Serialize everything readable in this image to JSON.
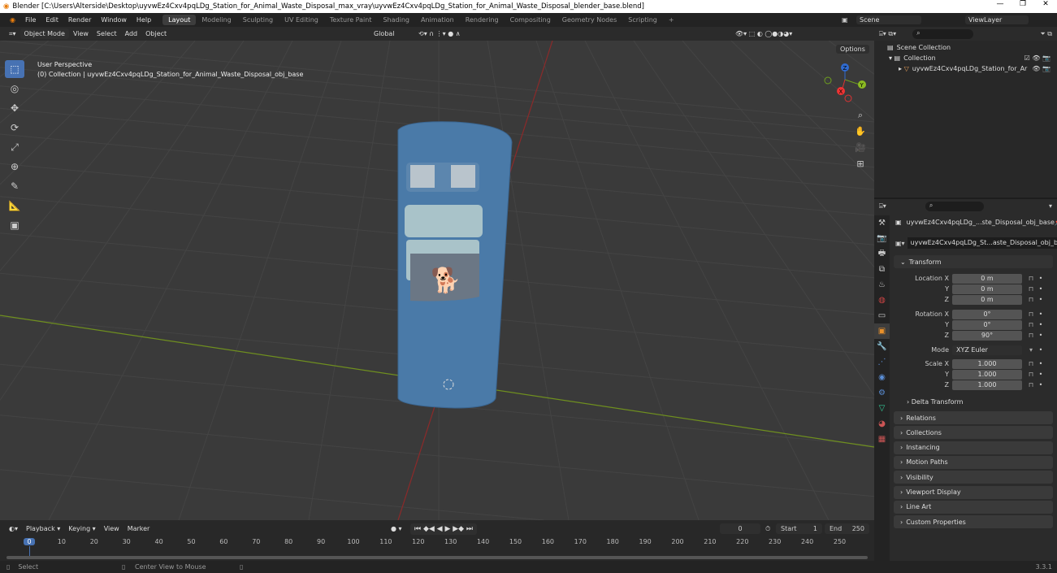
{
  "title": "Blender [C:\\Users\\Alterside\\Desktop\\uyvwEz4Cxv4pqLDg_Station_for_Animal_Waste_Disposal_max_vray\\uyvwEz4Cxv4pqLDg_Station_for_Animal_Waste_Disposal_blender_base.blend]",
  "menu": [
    "File",
    "Edit",
    "Render",
    "Window",
    "Help"
  ],
  "workspaces": [
    "Layout",
    "Modeling",
    "Sculpting",
    "UV Editing",
    "Texture Paint",
    "Shading",
    "Animation",
    "Rendering",
    "Compositing",
    "Geometry Nodes",
    "Scripting",
    "+"
  ],
  "scene": "Scene",
  "view_layer": "ViewLayer",
  "viewport_header": {
    "mode": "Object Mode",
    "menus": [
      "View",
      "Select",
      "Add",
      "Object"
    ],
    "orientation": "Global",
    "options": "Options"
  },
  "viewport_info": {
    "line1": "User Perspective",
    "line2": "(0) Collection | uyvwEz4Cxv4pqLDg_Station_for_Animal_Waste_Disposal_obj_base"
  },
  "gizmo": {
    "x": "X",
    "y": "Y",
    "z": "Z"
  },
  "outliner": {
    "root": "Scene Collection",
    "collection": "Collection",
    "object": "uyvwEz4Cxv4pqLDg_Station_for_Ar"
  },
  "properties": {
    "object_name": "uyvwEz4Cxv4pqLDg_...ste_Disposal_obj_base",
    "data_name": "uyvwEz4Cxv4pqLDg_St...aste_Disposal_obj_base",
    "transform": "Transform",
    "rows": [
      {
        "label": "Location X",
        "value": "0 m"
      },
      {
        "label": "Y",
        "value": "0 m"
      },
      {
        "label": "Z",
        "value": "0 m"
      },
      {
        "label": "Rotation X",
        "value": "0°"
      },
      {
        "label": "Y",
        "value": "0°"
      },
      {
        "label": "Z",
        "value": "90°"
      },
      {
        "label": "Mode",
        "value": "XYZ Euler"
      },
      {
        "label": "Scale X",
        "value": "1.000"
      },
      {
        "label": "Y",
        "value": "1.000"
      },
      {
        "label": "Z",
        "value": "1.000"
      }
    ],
    "delta": "Delta Transform",
    "panels": [
      "Relations",
      "Collections",
      "Instancing",
      "Motion Paths",
      "Visibility",
      "Viewport Display",
      "Line Art",
      "Custom Properties"
    ]
  },
  "timeline": {
    "menus": [
      "Playback",
      "Keying",
      "View",
      "Marker"
    ],
    "current": "0",
    "start_label": "Start",
    "start": "1",
    "end_label": "End",
    "end": "250",
    "ticks": [
      "0",
      "10",
      "20",
      "30",
      "40",
      "50",
      "60",
      "70",
      "80",
      "90",
      "100",
      "110",
      "120",
      "130",
      "140",
      "150",
      "160",
      "170",
      "180",
      "190",
      "200",
      "210",
      "220",
      "230",
      "240",
      "250"
    ]
  },
  "status": {
    "select": "Select",
    "center": "Center View to Mouse",
    "version": "3.3.1"
  },
  "colors": {
    "accent": "#4772b3",
    "object": "#4a7aa8",
    "x_axis": "#8b2a2a",
    "y_axis": "#6f8f1f"
  }
}
